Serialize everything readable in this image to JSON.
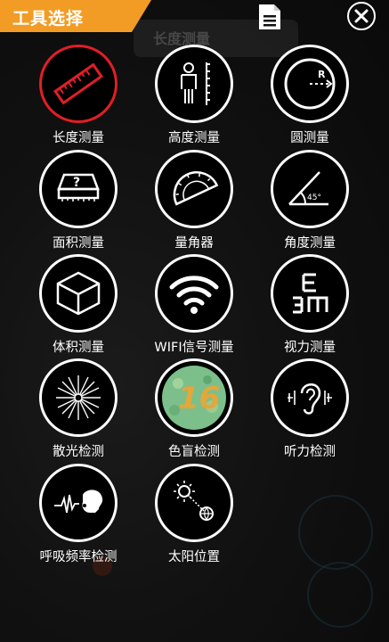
{
  "header": {
    "title": "工具选择",
    "background_label": "长度测量",
    "accent_color": "#f39c25"
  },
  "tools": [
    {
      "label": "长度测量",
      "icon": "ruler-icon",
      "highlighted": true
    },
    {
      "label": "高度测量",
      "icon": "person-height-icon",
      "highlighted": false
    },
    {
      "label": "圆测量",
      "icon": "circle-radius-icon",
      "highlighted": false
    },
    {
      "label": "面积测量",
      "icon": "area-box-icon",
      "highlighted": false
    },
    {
      "label": "量角器",
      "icon": "protractor-icon",
      "highlighted": false
    },
    {
      "label": "角度测量",
      "icon": "angle-icon",
      "highlighted": false
    },
    {
      "label": "体积测量",
      "icon": "cube-icon",
      "highlighted": false
    },
    {
      "label": "WIFI信号测量",
      "icon": "wifi-icon",
      "highlighted": false
    },
    {
      "label": "视力测量",
      "icon": "eye-chart-icon",
      "highlighted": false
    },
    {
      "label": "散光检测",
      "icon": "astigmatism-icon",
      "highlighted": false
    },
    {
      "label": "色盲检测",
      "icon": "color-blind-icon",
      "highlighted": false
    },
    {
      "label": "听力检测",
      "icon": "ear-icon",
      "highlighted": false
    },
    {
      "label": "呼吸频率检测",
      "icon": "breath-icon",
      "highlighted": false
    },
    {
      "label": "太阳位置",
      "icon": "sun-position-icon",
      "highlighted": false
    }
  ],
  "icon_texts": {
    "circle_r": "R",
    "angle_deg": "45°",
    "area_q": "?",
    "color_blind_number": "16"
  }
}
